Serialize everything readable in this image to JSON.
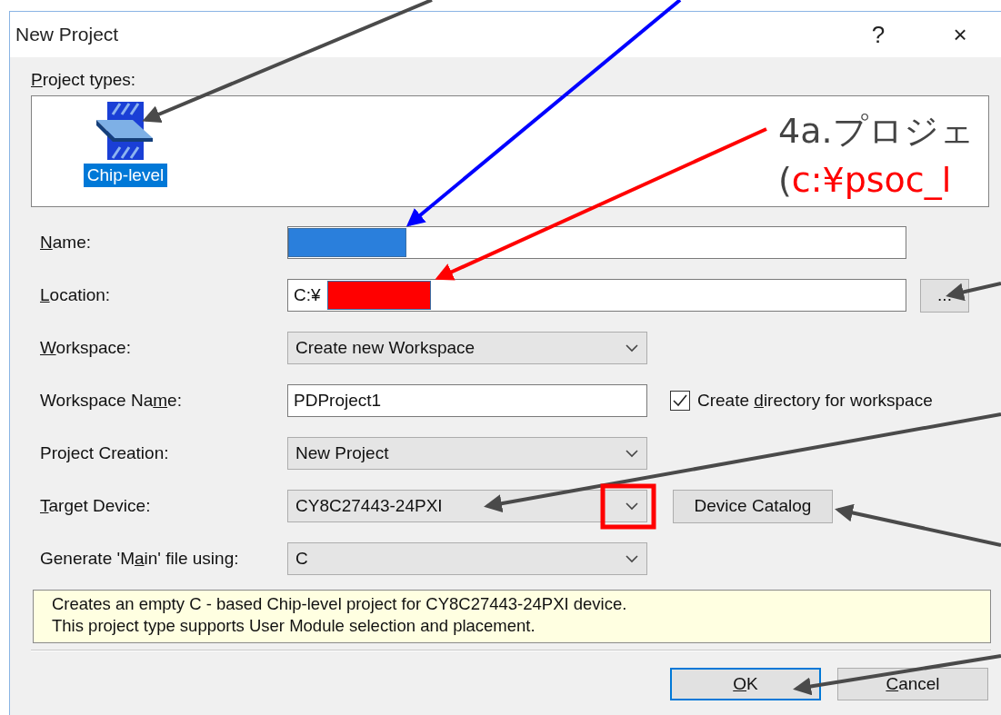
{
  "window": {
    "title": "New Project",
    "help": "?",
    "close": "×"
  },
  "project_types": {
    "label": {
      "key": "P",
      "after": "roject types:"
    },
    "items": [
      {
        "label": "Chip-level",
        "selected": true
      }
    ]
  },
  "fields": [
    {
      "kind": "wide_text",
      "label": {
        "key": "N",
        "after": "ame:"
      },
      "color": "#2a7fdc"
    },
    {
      "kind": "wide_text",
      "label": {
        "key": "L",
        "after": "ocation:"
      },
      "value": "C:¥",
      "color": "#ff0000",
      "browse": "..."
    },
    {
      "kind": "combo",
      "label": {
        "key": "W",
        "after": "orkspace:"
      },
      "value": "Create new Workspace"
    },
    {
      "kind": "text",
      "label": {
        "before": "Workspace Na",
        "key": "m",
        "after": "e:"
      },
      "value": "PDProject1",
      "checkbox": {
        "label": {
          "before": "Create ",
          "key": "d",
          "after": "irectory for workspace"
        },
        "checked": true
      }
    },
    {
      "kind": "combo",
      "label": {
        "after": "Project Creation:"
      },
      "value": "New Project"
    },
    {
      "kind": "combo",
      "label": {
        "key": "T",
        "after": "arget Device:"
      },
      "value": "CY8C27443-24PXI",
      "highlighted": true,
      "button": "Device Catalog"
    },
    {
      "kind": "combo",
      "label": {
        "before": "Generate 'M",
        "key": "a",
        "after": "in' file using:"
      },
      "value": "C"
    }
  ],
  "description": [
    "Creates an empty C - based Chip-level project for CY8C27443-24PXI device.",
    "This project type supports User Module selection and placement."
  ],
  "buttons": [
    {
      "label": {
        "key": "O",
        "after": "K"
      },
      "default": true
    },
    {
      "label": {
        "key": "C",
        "after": "ancel"
      },
      "default": false
    }
  ],
  "callout": {
    "title": "4a.プロジェ",
    "open": "(",
    "path": "c:¥psoc_l"
  }
}
